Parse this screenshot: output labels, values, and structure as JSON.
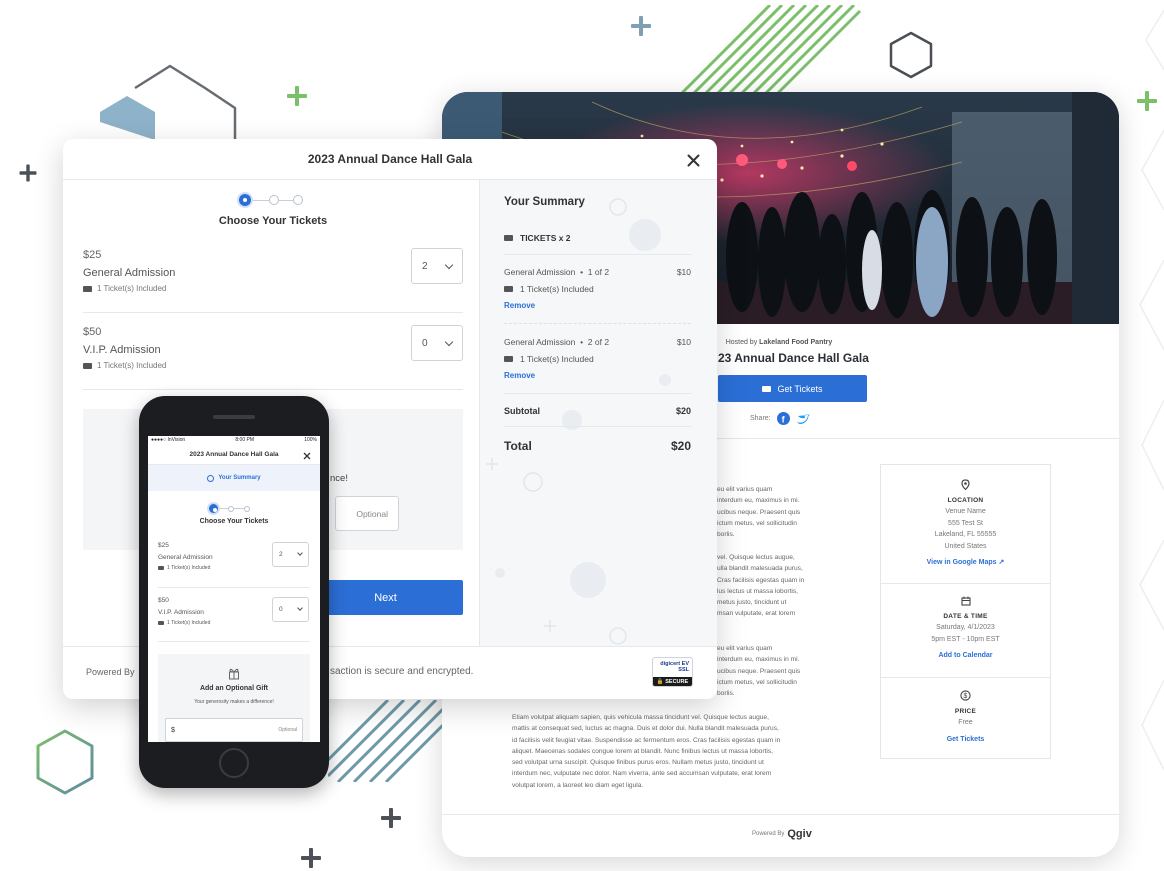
{
  "modal": {
    "title": "2023 Annual Dance Hall Gala",
    "step_label": "Choose Your Tickets",
    "tickets": [
      {
        "price": "$25",
        "name": "General Admission",
        "included": "1 Ticket(s) Included",
        "qty": "2"
      },
      {
        "price": "$50",
        "name": "V.I.P. Admission",
        "included": "1 Ticket(s) Included",
        "qty": "0"
      }
    ],
    "gift_partial": "nce!",
    "optional_placeholder": "Optional",
    "next_label": "Next",
    "footer_left": "Powered By",
    "footer_secure": "saction is secure and encrypted.",
    "badge_top": "digicert EV SSL",
    "badge_bottom": "SECURE"
  },
  "summary": {
    "title": "Your Summary",
    "tickets_count": "TICKETS x 2",
    "items": [
      {
        "name": "General Admission",
        "index": "1 of 2",
        "amount": "$10",
        "included": "1 Ticket(s) Included",
        "remove": "Remove"
      },
      {
        "name": "General Admission",
        "index": "2 of 2",
        "amount": "$10",
        "included": "1 Ticket(s) Included",
        "remove": "Remove"
      }
    ],
    "subtotal_label": "Subtotal",
    "subtotal_value": "$20",
    "total_label": "Total",
    "total_value": "$20"
  },
  "event": {
    "hosted_prefix": "Hosted by",
    "host": "Lakeland Food Pantry",
    "title": "23 Annual Dance Hall Gala",
    "get_tickets": "Get Tickets",
    "share": "Share:",
    "paragraphs": [
      [
        "eu elit varius quam",
        "interdum eu, maximus in mi.",
        "ucibus neque. Praesent quis",
        "ictum metus, vel sollicitudin",
        "borlis."
      ],
      [
        "vel. Quisque lectus augue,",
        "ulla blandit malesuada purus,",
        "Cras facilisis egestas quam in",
        "lus lectus ut massa lobortis,",
        "metus justo, tincidunt ut",
        "msan vulputate, erat lorem"
      ],
      [
        "eu elit varius quam",
        "interdum eu, maximus in mi.",
        "ucibus neque. Praesent quis",
        "ictum metus, vel sollicitudin",
        "borlis."
      ],
      [
        "Etiam volutpat aliquam sapien, quis vehicula massa tincidunt vel. Quisque lectus augue,",
        "mattis at consequat sed, luctus ac magna. Duis et dolor dui. Nulla blandit malesuada purus,",
        "id facilisis velit feugiat vitae. Suspendisse ac fermentum eros. Cras facilisis egestas quam in",
        "aliquet. Maecenas sodales congue lorem at blandit. Nunc finibus lectus ut massa lobortis,",
        "sed volutpat urna suscipit. Quisque finibus purus eros. Nullam metus justo, tincidunt ut",
        "interdum nec, vulputate nec dolor. Nam viverra, ante sed accumsan vulputate, erat lorem",
        "volutpat lorem, a laoreet leo diam eget ligula."
      ]
    ],
    "location": {
      "heading": "LOCATION",
      "lines": [
        "Venue Name",
        "555 Test St",
        "Lakeland, FL 55555",
        "United States"
      ],
      "link": "View in Google Maps"
    },
    "datetime": {
      "heading": "DATE & TIME",
      "lines": [
        "Saturday, 4/1/2023",
        "5pm EST - 10pm EST"
      ],
      "link": "Add to Calendar"
    },
    "price": {
      "heading": "PRICE",
      "value": "Free",
      "link": "Get Tickets"
    },
    "powered": "Powered By",
    "brand": "Qgiv"
  },
  "phone": {
    "carrier": "●●●●○ InVision",
    "time": "8:00 PM",
    "battery": "100%",
    "title": "2023 Annual Dance Hall Gala",
    "summary_link": "Your Summary",
    "step_label": "Choose Your Tickets",
    "tickets": [
      {
        "price": "$25",
        "name": "General Admission",
        "included": "1 Ticket(s) Included",
        "qty": "2"
      },
      {
        "price": "$50",
        "name": "V.I.P. Admission",
        "included": "1 Ticket(s) Included",
        "qty": "0"
      }
    ],
    "gift_title": "Add an Optional Gift",
    "gift_sub": "Your generosity makes a difference!",
    "gift_currency": "$",
    "gift_optional": "Optional"
  },
  "colors": {
    "accent": "#2b6fd6",
    "green": "#7bbf6a",
    "slate": "#5f8aa3"
  }
}
